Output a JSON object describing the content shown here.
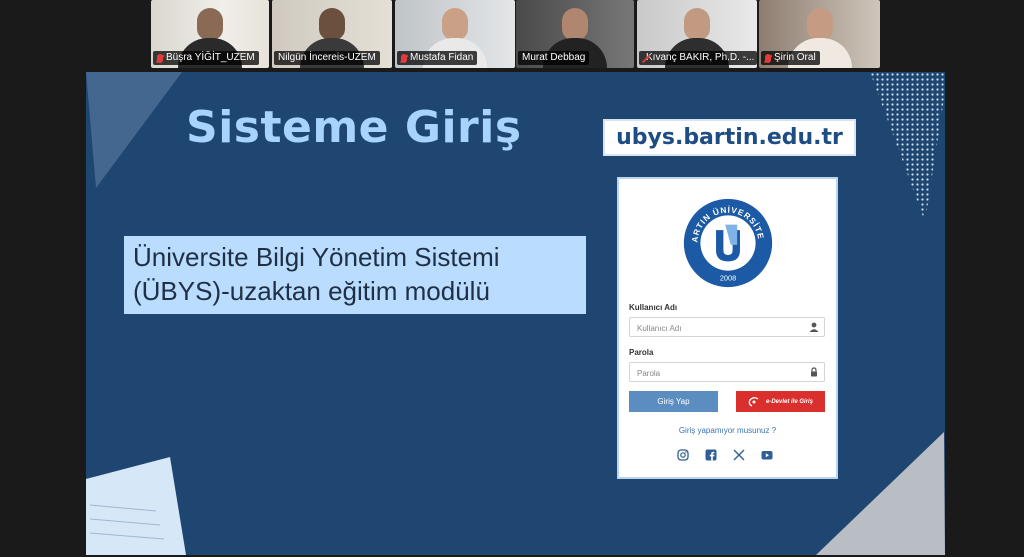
{
  "participants": [
    {
      "name": "Büşra YİĞİT_UZEM",
      "muted": true,
      "active": false
    },
    {
      "name": "Nilgün İncereis-UZEM",
      "muted": false,
      "active": true
    },
    {
      "name": "Mustafa Fidan",
      "muted": true,
      "active": false
    },
    {
      "name": "Murat Debbag",
      "muted": false,
      "active": false
    },
    {
      "name": "Kıvanç BAKIR, Ph.D. -...",
      "muted": true,
      "active": false
    },
    {
      "name": "Şirin Oral",
      "muted": true,
      "active": false
    }
  ],
  "slide": {
    "title": "Sisteme Giriş",
    "url": "ubys.bartin.edu.tr",
    "subtitle_line1": "Üniversite Bilgi Yönetim Sistemi",
    "subtitle_line2": "(ÜBYS)-uzaktan eğitim modülü"
  },
  "login": {
    "logo_top_text": "BARTIN ÜNİVERSİTESİ",
    "logo_year": "2008",
    "username_label": "Kullanıcı Adı",
    "username_placeholder": "Kullanıcı Adı",
    "password_label": "Parola",
    "password_placeholder": "Parola",
    "login_button": "Giriş Yap",
    "edevlet_button": "e-Devlet ile Giriş",
    "forgot_link": "Giriş yapamıyor musunuz ?",
    "social_icons": [
      "instagram-icon",
      "facebook-icon",
      "x-icon",
      "youtube-icon"
    ]
  },
  "colors": {
    "slide_bg": "#1f4670",
    "title": "#a9d3ff",
    "subtitle_bg": "#b9dcff",
    "login_button": "#5b8dc1",
    "edevlet_button": "#d9302e",
    "logo_blue": "#1c5aa6"
  }
}
